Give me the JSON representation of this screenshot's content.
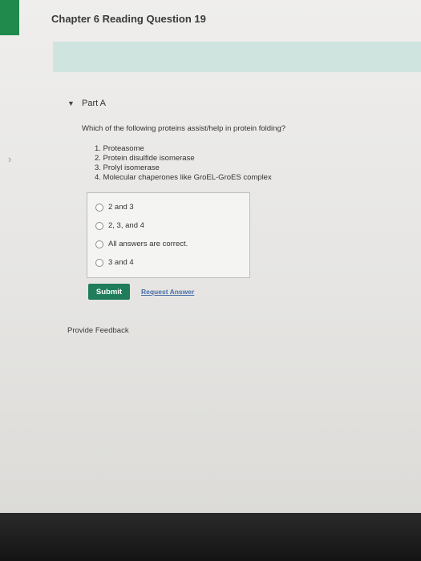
{
  "page": {
    "title": "Chapter 6 Reading Question 19"
  },
  "part": {
    "label": "Part A"
  },
  "question": {
    "text": "Which of the following proteins assist/help in protein folding?",
    "options": [
      "1. Proteasome",
      "2. Protein disulfide isomerase",
      "3. Prolyl isomerase",
      "4. Molecular chaperones like GroEL-GroES complex"
    ]
  },
  "choices": [
    "2 and 3",
    "2, 3, and 4",
    "All answers are correct.",
    "3 and 4"
  ],
  "actions": {
    "submit_label": "Submit",
    "request_answer_label": "Request Answer",
    "feedback_label": "Provide Feedback"
  },
  "colors": {
    "accent_green": "#1f7d5c",
    "banner": "#cfe4de",
    "link_blue": "#4a6fa8"
  }
}
